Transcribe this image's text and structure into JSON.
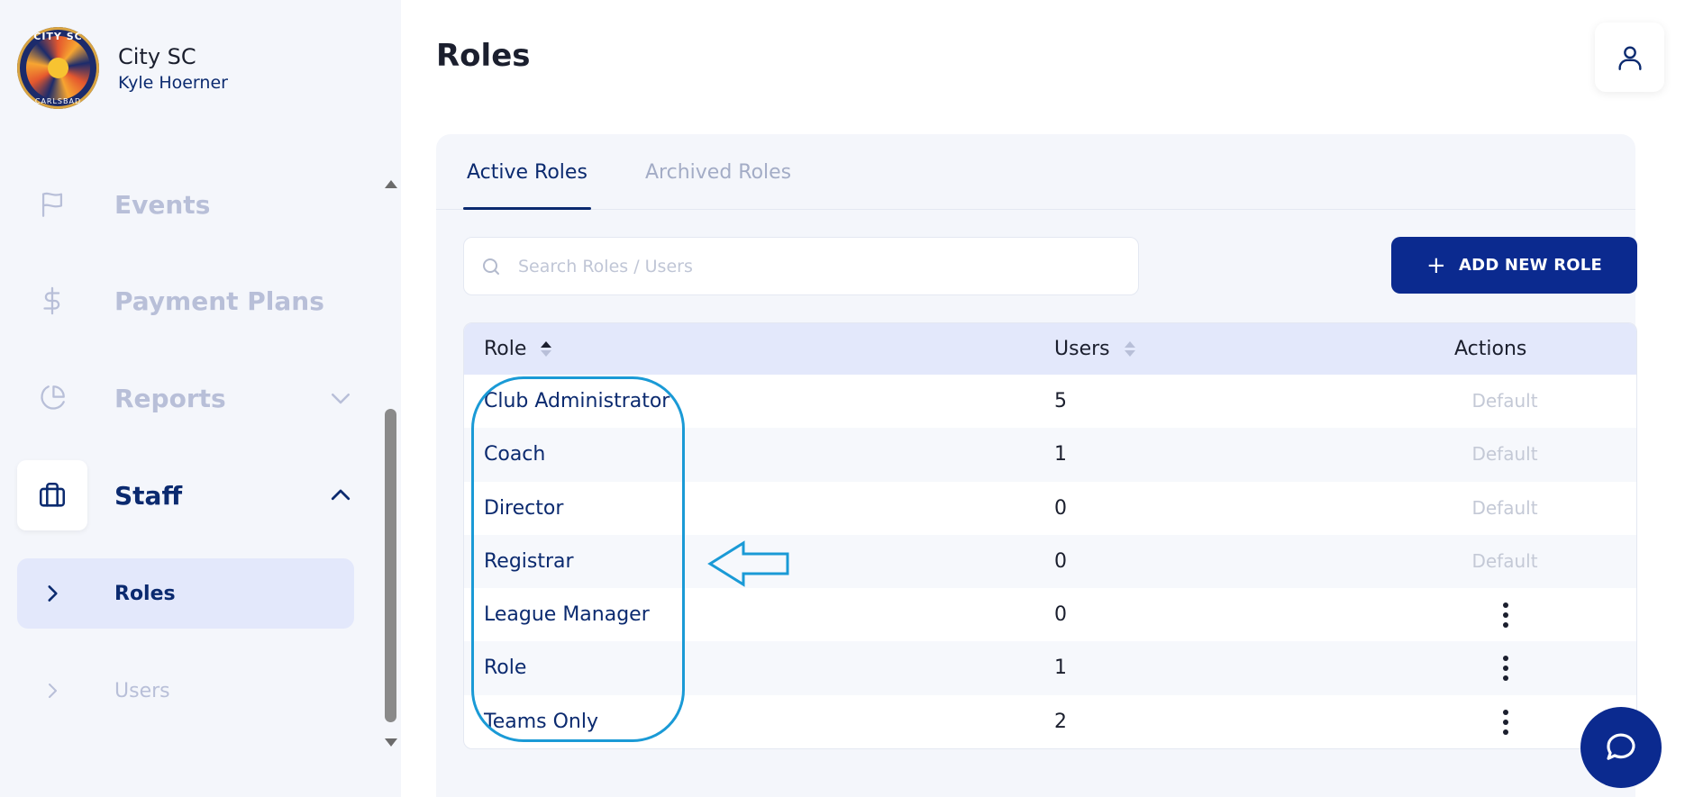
{
  "club": {
    "name": "City SC",
    "user": "Kyle Hoerner",
    "logo_top": "CITY SC",
    "logo_bottom": "CARLSBAD"
  },
  "sidebar": {
    "items": [
      {
        "label": "Events",
        "icon": "flag-icon"
      },
      {
        "label": "Payment Plans",
        "icon": "dollar-icon"
      },
      {
        "label": "Reports",
        "icon": "pie-chart-icon"
      },
      {
        "label": "Staff",
        "icon": "briefcase-icon"
      }
    ],
    "subitems": [
      {
        "label": "Roles"
      },
      {
        "label": "Users"
      }
    ]
  },
  "page": {
    "title": "Roles"
  },
  "tabs": [
    {
      "label": "Active Roles",
      "active": true
    },
    {
      "label": "Archived Roles",
      "active": false
    }
  ],
  "search": {
    "placeholder": "Search Roles / Users",
    "value": ""
  },
  "toolbar": {
    "add_label": "ADD NEW ROLE"
  },
  "table": {
    "headers": {
      "role": "Role",
      "users": "Users",
      "actions": "Actions"
    },
    "rows": [
      {
        "role": "Club Administrator",
        "users": "5",
        "action": "Default"
      },
      {
        "role": "Coach",
        "users": "1",
        "action": "Default"
      },
      {
        "role": "Director",
        "users": "0",
        "action": "Default"
      },
      {
        "role": "Registrar",
        "users": "0",
        "action": "Default"
      },
      {
        "role": "League Manager",
        "users": "0",
        "action": "menu"
      },
      {
        "role": "Role",
        "users": "1",
        "action": "menu"
      },
      {
        "role": "Teams Only",
        "users": "2",
        "action": "menu"
      }
    ]
  },
  "colors": {
    "brand": "#0b2a8f",
    "annotation": "#1a9ad6"
  }
}
